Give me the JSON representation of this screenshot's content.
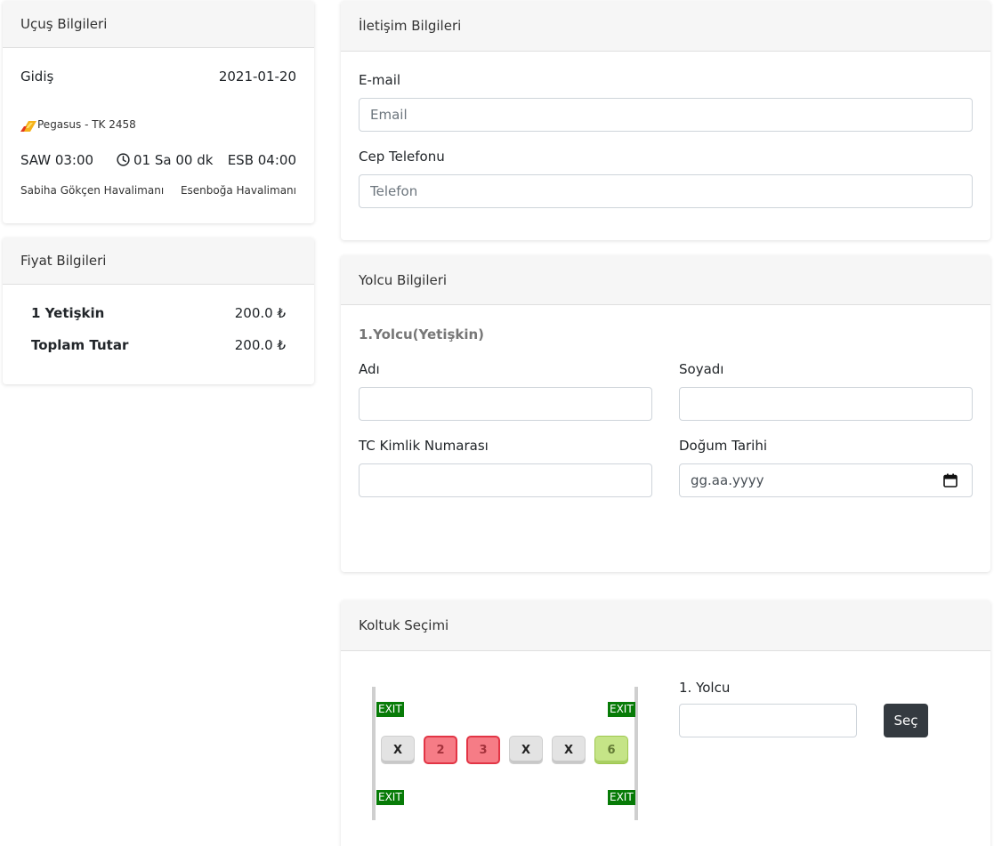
{
  "flight": {
    "title": "Uçuş Bilgileri",
    "direction": "Gidiş",
    "date": "2021-01-20",
    "airline": "Pegasus - TK 2458",
    "departure": "SAW 03:00",
    "duration": "01 Sa 00 dk",
    "arrival": "ESB 04:00",
    "departure_airport": "Sabiha Gökçen Havalimanı",
    "arrival_airport": "Esenboğa Havalimanı"
  },
  "price": {
    "title": "Fiyat Bilgileri",
    "rows": [
      {
        "label": "1 Yetişkin",
        "value": "200.0 ₺"
      },
      {
        "label": "Toplam Tutar",
        "value": "200.0 ₺"
      }
    ]
  },
  "contact": {
    "title": "İletişim Bilgileri",
    "email_label": "E-mail",
    "email_placeholder": "Email",
    "phone_label": "Cep Telefonu",
    "phone_placeholder": "Telefon"
  },
  "passenger": {
    "title": "Yolcu Bilgileri",
    "subtitle": "1.Yolcu(Yetişkin)",
    "first_name_label": "Adı",
    "last_name_label": "Soyadı",
    "tc_label": "TC Kimlik Numarası",
    "birth_label": "Doğum Tarihi",
    "birth_placeholder": "gg.aa.yyyy"
  },
  "seat": {
    "title": "Koltuk Seçimi",
    "exit_label": "EXIT",
    "seats": [
      {
        "label": "X",
        "status": "taken"
      },
      {
        "label": "2",
        "status": "reserved"
      },
      {
        "label": "3",
        "status": "reserved"
      },
      {
        "label": "X",
        "status": "taken"
      },
      {
        "label": "X",
        "status": "taken"
      },
      {
        "label": "6",
        "status": "available"
      }
    ],
    "passenger_label": "1. Yolcu",
    "select_button": "Seç"
  },
  "colors": {
    "exit": "#077b07",
    "reserved": "#f67c86",
    "available": "#c5e487",
    "button": "#343a40"
  },
  "icons": {
    "airline": "pegasus-logo-icon",
    "duration": "clock-icon",
    "date_picker": "calendar-icon"
  }
}
